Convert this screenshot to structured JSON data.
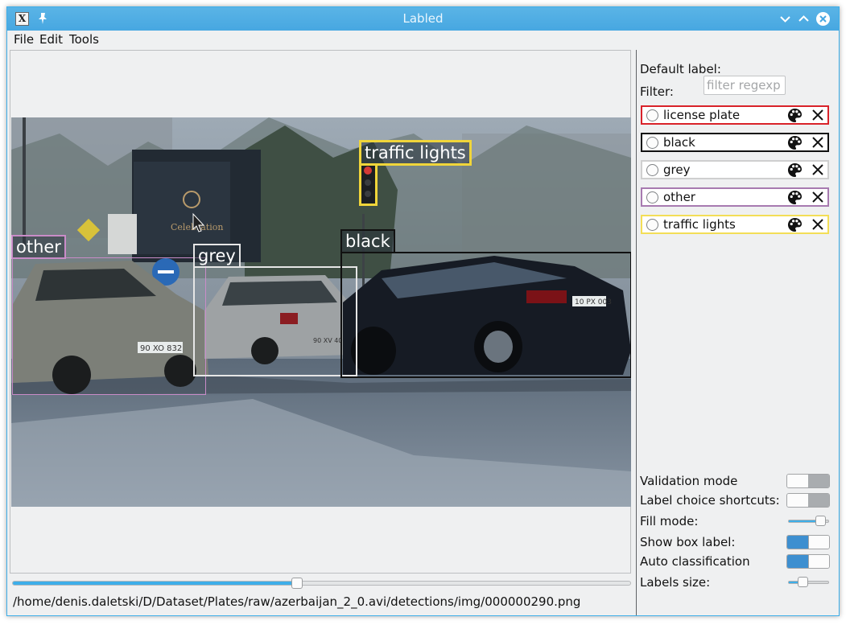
{
  "window": {
    "title": "Labled"
  },
  "menu": [
    "File",
    "Edit",
    "Tools"
  ],
  "image": {
    "boxes": [
      {
        "label": "other",
        "color": "#c98cc8"
      },
      {
        "label": "grey",
        "color": "#e6e6e6"
      },
      {
        "label": "black",
        "color": "#111111"
      },
      {
        "label": "traffic lights",
        "color": "#f0d53a"
      }
    ],
    "plate_texts": [
      "90 XO 832",
      "10 PX 003",
      "90 XV 400"
    ]
  },
  "frame_slider": {
    "value_percent": 46
  },
  "status": {
    "path": "/home/denis.daletski/D/Dataset/Plates/raw/azerbaijan_2_0.avi/detections/img/000000290.png"
  },
  "panel": {
    "default_label_text": "Default label:",
    "filter_text": "Filter:",
    "filter_placeholder": "filter regexp",
    "labels": [
      {
        "name": "license plate",
        "color": "#d9222a"
      },
      {
        "name": "black",
        "color": "#111111"
      },
      {
        "name": "grey",
        "color": "#cfcfcf"
      },
      {
        "name": "other",
        "color": "#a77ab0"
      },
      {
        "name": "traffic lights",
        "color": "#f3de57"
      }
    ],
    "settings": [
      {
        "label": "Validation mode",
        "control": "toggle",
        "on": false
      },
      {
        "label": "Label choice shortcuts:",
        "control": "toggle",
        "on": false
      },
      {
        "label": "Fill mode:",
        "control": "slider",
        "value_percent": 92
      },
      {
        "label": "Show box label:",
        "control": "toggle",
        "on": true
      },
      {
        "label": "Auto classification",
        "control": "toggle",
        "on": true
      },
      {
        "label": "Labels size:",
        "control": "slider",
        "value_percent": 30
      }
    ]
  }
}
